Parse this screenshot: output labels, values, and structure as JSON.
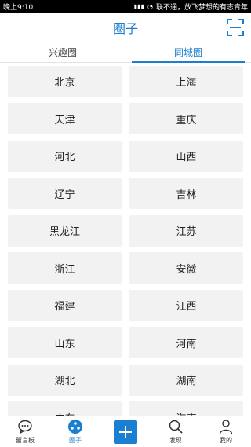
{
  "status_bar": {
    "time": "晚上9:10",
    "carrier": "联不通，放飞梦想的有志青年"
  },
  "header": {
    "title": "圈子"
  },
  "tabs": [
    {
      "label": "兴趣圈",
      "active": false
    },
    {
      "label": "同城圈",
      "active": true
    }
  ],
  "regions": [
    [
      "北京",
      "上海"
    ],
    [
      "天津",
      "重庆"
    ],
    [
      "河北",
      "山西"
    ],
    [
      "辽宁",
      "吉林"
    ],
    [
      "黑龙江",
      "江苏"
    ],
    [
      "浙江",
      "安徽"
    ],
    [
      "福建",
      "江西"
    ],
    [
      "山东",
      "河南"
    ],
    [
      "湖北",
      "湖南"
    ],
    [
      "广东",
      "海南"
    ]
  ],
  "bottom_nav": [
    {
      "label": "留言板",
      "icon": "chat-bubble-icon"
    },
    {
      "label": "圈子",
      "icon": "circle-group-icon",
      "active": true
    },
    {
      "label": "",
      "icon": "plus-icon"
    },
    {
      "label": "发现",
      "icon": "search-icon"
    },
    {
      "label": "我的",
      "icon": "person-icon"
    }
  ],
  "colors": {
    "accent": "#1a7fd1",
    "cell_bg": "#f2f2f2"
  }
}
